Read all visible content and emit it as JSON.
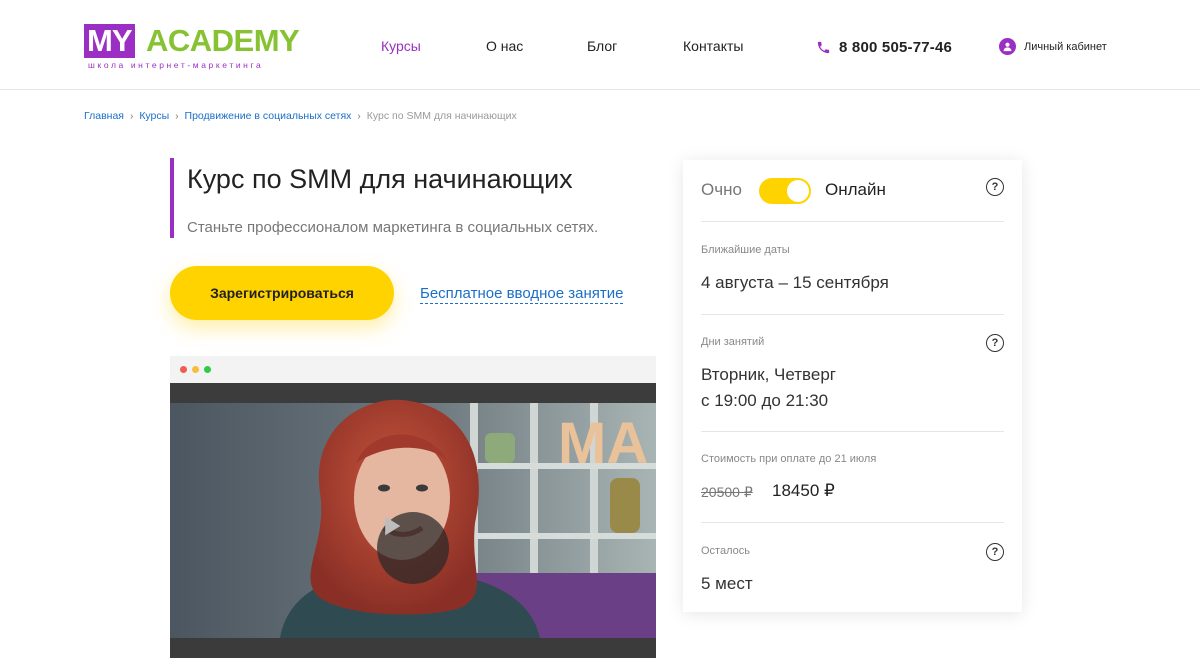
{
  "header": {
    "logo_my": "MY",
    "logo_academy": "ACADEMY",
    "logo_sub": "школа интернет-маркетинга",
    "nav": [
      {
        "label": "Курсы",
        "active": true
      },
      {
        "label": "О нас",
        "active": false
      },
      {
        "label": "Блог",
        "active": false
      },
      {
        "label": "Контакты",
        "active": false
      }
    ],
    "phone": "8 800 505-77-46",
    "account_label": "Личный кабинет"
  },
  "breadcrumb": {
    "items": [
      "Главная",
      "Курсы",
      "Продвижение в социальных сетях"
    ],
    "current": "Курс по SMM для начинающих"
  },
  "main": {
    "title": "Курс по SMM для начинающих",
    "subtitle": "Станьте профессионалом маркетинга в социальных сетях.",
    "register_button": "Зарегистрироваться",
    "free_lesson_link": "Бесплатное вводное занятие",
    "video_sign": "MA"
  },
  "card": {
    "mode_offline": "Очно",
    "mode_online": "Онлайн",
    "mode_online_selected": true,
    "help_symbol": "?",
    "dates_label": "Ближайшие даты",
    "dates_value": "4 августа – 15 сентября",
    "days_label": "Дни занятий",
    "days_value_line1": "Вторник, Четверг",
    "days_value_line2": "с 19:00 до 21:30",
    "price_label": "Стоимость при оплате до 21 июля",
    "old_price": "20500 ₽",
    "new_price": "18450 ₽",
    "left_label": "Осталось",
    "left_value": "5 мест"
  },
  "colors": {
    "brand_purple": "#9b2fc4",
    "brand_green": "#86c232",
    "accent_yellow": "#ffd300",
    "link_blue": "#1b6fc8"
  }
}
